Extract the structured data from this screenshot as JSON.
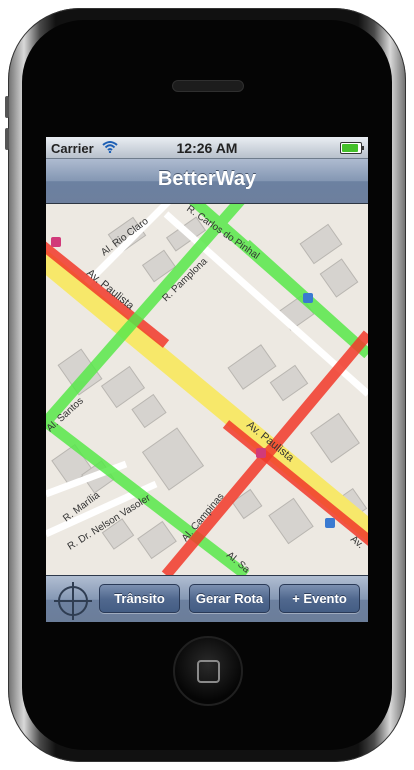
{
  "status_bar": {
    "carrier": "Carrier",
    "time": "12:26 AM",
    "battery_level": 1.0
  },
  "nav_bar": {
    "title": "BetterWay"
  },
  "map": {
    "street_labels": {
      "al_rio_claro": "Al. Rio Claro",
      "r_carlos_do_pinhal": "R. Carlos do Pinhal",
      "r_pamplona": "R. Pamplona",
      "av_paulista_1": "Av. Paulista",
      "av_paulista_2": "Av. Paulista",
      "al_santos": "Al. Santos",
      "al_campinas": "Al. Campinas",
      "r_marilia": "R. Marília",
      "r_dr_nelson_vasoler": "R. Dr. Nelson Vasoler",
      "al_santos_2": "Al. Sa",
      "av_partial": "Av."
    },
    "traffic_colors": {
      "free": "#58e84a",
      "moderate": "#f7e86a",
      "heavy": "#f23a2a"
    }
  },
  "toolbar": {
    "locate_icon": "crosshair-icon",
    "transito": "Trânsito",
    "gerar_rota": "Gerar Rota",
    "evento": "+ Evento"
  }
}
